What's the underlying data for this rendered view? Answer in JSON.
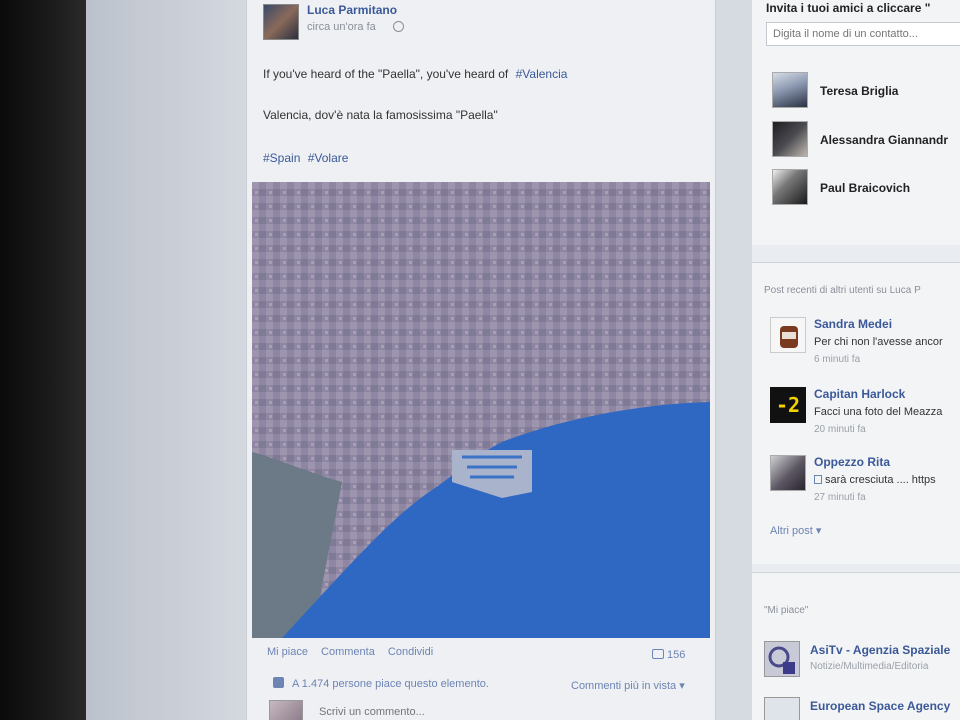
{
  "post": {
    "author": "Luca Parmitano",
    "timestamp": "circa un'ora fa",
    "text_line1_prefix": "If you've heard of the \"Paella\", you've heard of",
    "text_line1_tag": "#Valencia",
    "text_line2": "Valencia, dov'è nata la famosissima \"Paella\"",
    "tags_line3": [
      "#Spain",
      "#Volare"
    ],
    "actions": [
      "Mi piace",
      "Commenta",
      "Condividi"
    ],
    "share_count": "156",
    "likes_text": "A 1.474 persone piace questo elemento.",
    "more_comments": "Commenti più in vista ▾",
    "comment_placeholder": "Scrivi un commento..."
  },
  "sidebar": {
    "invite_title": "Invita i tuoi amici a cliccare \"",
    "invite_placeholder": "Digita il nome di un contatto...",
    "friends": [
      {
        "name": "Teresa Briglia"
      },
      {
        "name": "Alessandra Giannandr"
      },
      {
        "name": "Paul Braicovich"
      }
    ],
    "recent_posts_title": "Post recenti di altri utenti su Luca P",
    "recent_posts": [
      {
        "name": "Sandra Medei",
        "text": "Per chi non l'avesse ancor",
        "time": "6 minuti fa",
        "badge": ""
      },
      {
        "name": "Capitan Harlock",
        "text": "Facci una foto del Meazza",
        "time": "20 minuti fa",
        "badge": "-2"
      },
      {
        "name": "Oppezzo Rita",
        "text": "sarà cresciuta .... https",
        "time": "27 minuti fa",
        "badge": ""
      }
    ],
    "other_posts": "Altri post ▾",
    "likes_title": "\"Mi piace\"",
    "pages": [
      {
        "name": "AsiTv - Agenzia Spaziale",
        "category": "Notizie/Multimedia/Editoria"
      },
      {
        "name": "European Space Agency",
        "category": ""
      }
    ]
  },
  "colors": {
    "link": "#3b5998",
    "muted_link": "#6d84b4",
    "sea": "#2f68c2"
  }
}
